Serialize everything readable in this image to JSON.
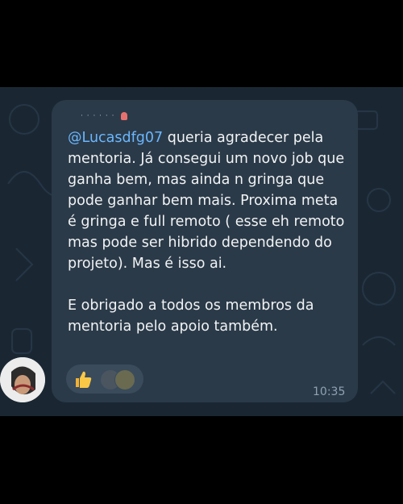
{
  "message": {
    "mention": "@Lucasdfg07",
    "text_after_mention": " queria agradecer pela mentoria. Já consegui um novo job que ganha bem, mas ainda n gringa que pode ganhar bem mais. Proxima meta é gringa e full remoto ( esse eh remoto mas pode ser hibrido dependendo do projeto). Mas é isso ai.",
    "paragraph2": "E obrigado a todos os membros da mentoria pelo apoio também.",
    "time": "10:35"
  },
  "icons": {
    "reaction": "thumbs-up-icon",
    "sender_badge": "badge-icon"
  },
  "colors": {
    "bubble": "#2b3a48",
    "background": "#1a2733",
    "mention": "#6ab7ff",
    "text": "#f1f3f5",
    "time": "#8ea2b5"
  }
}
